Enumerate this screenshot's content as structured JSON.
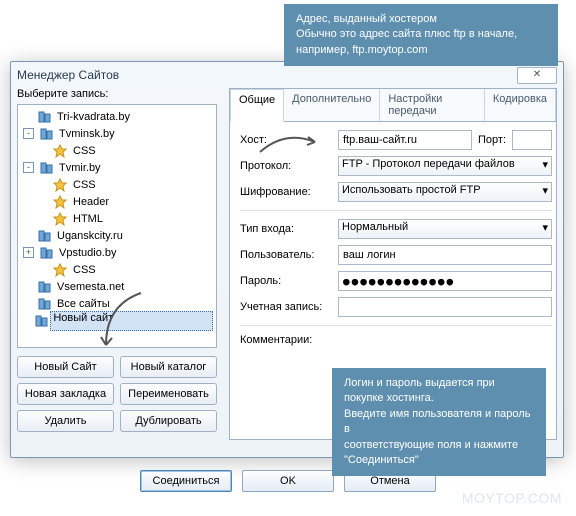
{
  "callout_top": {
    "l1": "Адрес, выданный хостером",
    "l2": "Обычно это адрес сайта плюс ftp в начале,",
    "l3": "например, ftp.moytop.com"
  },
  "callout_bottom": {
    "l1": "Логин и пароль выдается при покупке хостинга.",
    "l2": "Введите имя пользователя и пароль в",
    "l3": "соответствующие поля и нажмите \"Соединиться\""
  },
  "window": {
    "title": "Менеджер Сайтов",
    "close_symbol": "✕"
  },
  "left": {
    "select_label": "Выберите запись:",
    "tree": [
      {
        "l": 0,
        "exp": "",
        "icon": "site",
        "t": "Tri-kvadrata.by"
      },
      {
        "l": 0,
        "exp": "-",
        "icon": "site",
        "t": "Tvminsk.by"
      },
      {
        "l": 1,
        "exp": "",
        "icon": "star",
        "t": "CSS"
      },
      {
        "l": 0,
        "exp": "-",
        "icon": "site",
        "t": "Tvmir.by"
      },
      {
        "l": 1,
        "exp": "",
        "icon": "star",
        "t": "CSS"
      },
      {
        "l": 1,
        "exp": "",
        "icon": "star",
        "t": "Header"
      },
      {
        "l": 1,
        "exp": "",
        "icon": "star",
        "t": "HTML"
      },
      {
        "l": 0,
        "exp": "",
        "icon": "site",
        "t": "Uganskcity.ru"
      },
      {
        "l": 0,
        "exp": "+",
        "icon": "site",
        "t": "Vpstudio.by"
      },
      {
        "l": 1,
        "exp": "",
        "icon": "star",
        "t": "CSS"
      },
      {
        "l": 0,
        "exp": "",
        "icon": "site",
        "t": "Vsemesta.net"
      },
      {
        "l": 0,
        "exp": "",
        "icon": "site",
        "t": "Все сайты"
      },
      {
        "l": 0,
        "exp": "",
        "icon": "site",
        "t": "Новый сайт",
        "sel": true
      }
    ],
    "buttons": {
      "new_site": "Новый Сайт",
      "new_dir": "Новый каталог",
      "new_bm": "Новая закладка",
      "rename": "Переименовать",
      "delete": "Удалить",
      "dup": "Дублировать"
    }
  },
  "tabs": {
    "general": "Общие",
    "advanced": "Дополнительно",
    "transfer": "Настройки передачи",
    "encoding": "Кодировка"
  },
  "form": {
    "host_label": "Хост:",
    "host_value": "ftp.ваш-сайт.ru",
    "port_label": "Порт:",
    "port_value": "",
    "protocol_label": "Протокол:",
    "protocol_value": "FTP - Протокол передачи файлов",
    "enc_label": "Шифрование:",
    "enc_value": "Использовать простой FTP",
    "login_type_label": "Тип входа:",
    "login_type_value": "Нормальный",
    "user_label": "Пользователь:",
    "user_value": "ваш логин",
    "pass_label": "Пароль:",
    "pass_value": "●●●●●●●●●●●●●",
    "acct_label": "Учетная запись:",
    "acct_value": "",
    "comment_label": "Комментарии:"
  },
  "bottom": {
    "connect": "Соединиться",
    "ok": "OK",
    "cancel": "Отмена"
  },
  "watermark": "MOYTOP.COM"
}
